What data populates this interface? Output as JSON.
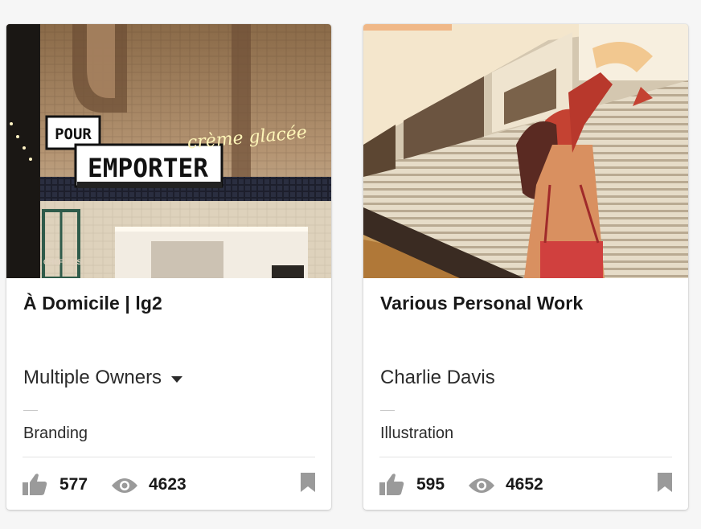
{
  "projects": [
    {
      "title": "À Domicile | lg2",
      "owner": "Multiple Owners",
      "owner_has_dropdown": true,
      "field": "Branding",
      "appreciations": "577",
      "views": "4623",
      "cover_text": {
        "sign_small": "POUR",
        "sign_large": "EMPORTER",
        "neon": "crème glacée",
        "wall": "CHEF VIES"
      }
    },
    {
      "title": "Various Personal Work",
      "owner": "Charlie Davis",
      "owner_has_dropdown": false,
      "field": "Illustration",
      "appreciations": "595",
      "views": "4652"
    }
  ],
  "icons": {
    "appreciate": "thumbs-up-icon",
    "views": "eye-icon",
    "save": "bookmark-icon",
    "owners_menu": "caret-down-icon"
  },
  "colors": {
    "icon_gray": "#9a9a9a",
    "text": "#191919",
    "background": "#f6f6f6"
  }
}
